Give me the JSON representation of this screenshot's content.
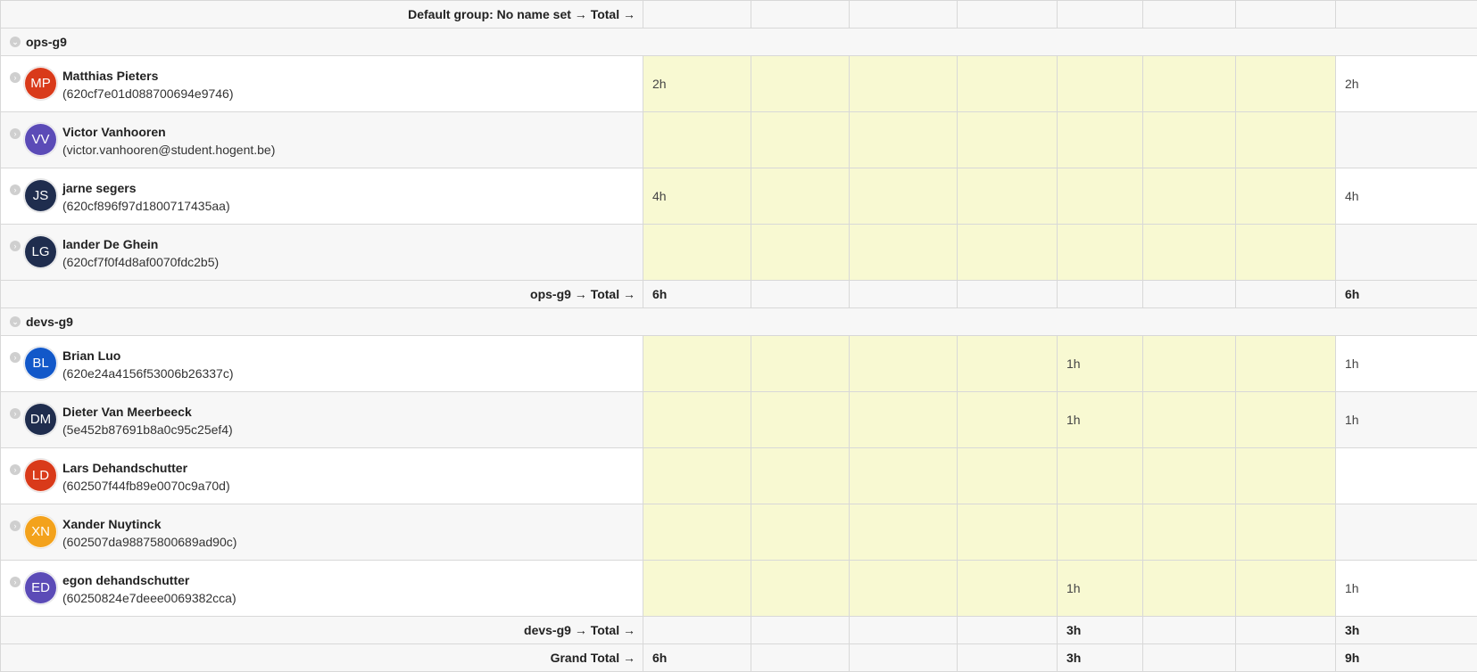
{
  "default_total": {
    "label": "Default group: No name set → Total →"
  },
  "groups": [
    {
      "name": "ops-g9",
      "members": [
        {
          "initials": "MP",
          "name": "Matthias Pieters",
          "sub": "(620cf7e01d088700694e9746)",
          "color": "#d93a1a",
          "days": [
            "2h",
            "",
            "",
            "",
            "",
            "",
            ""
          ],
          "total": "2h"
        },
        {
          "initials": "VV",
          "name": "Victor Vanhooren",
          "sub": "(victor.vanhooren@student.hogent.be)",
          "color": "#5b4bb7",
          "days": [
            "",
            "",
            "",
            "",
            "",
            "",
            ""
          ],
          "total": ""
        },
        {
          "initials": "JS",
          "name": "jarne segers",
          "sub": "(620cf896f97d1800717435aa)",
          "color": "#1f2d4e",
          "days": [
            "4h",
            "",
            "",
            "",
            "",
            "",
            ""
          ],
          "total": "4h"
        },
        {
          "initials": "LG",
          "name": "lander De Ghein",
          "sub": "(620cf7f0f4d8af0070fdc2b5)",
          "color": "#1f2d4e",
          "days": [
            "",
            "",
            "",
            "",
            "",
            "",
            ""
          ],
          "total": ""
        }
      ],
      "total": {
        "label": "ops-g9 → Total →",
        "days": [
          "6h",
          "",
          "",
          "",
          "",
          "",
          ""
        ],
        "total": "6h"
      }
    },
    {
      "name": "devs-g9",
      "members": [
        {
          "initials": "BL",
          "name": "Brian Luo",
          "sub": "(620e24a4156f53006b26337c)",
          "color": "#1258c9",
          "days": [
            "",
            "",
            "",
            "",
            "1h",
            "",
            ""
          ],
          "total": "1h"
        },
        {
          "initials": "DM",
          "name": "Dieter Van Meerbeeck",
          "sub": "(5e452b87691b8a0c95c25ef4)",
          "color": "#1f2d4e",
          "days": [
            "",
            "",
            "",
            "",
            "1h",
            "",
            ""
          ],
          "total": "1h"
        },
        {
          "initials": "LD",
          "name": "Lars Dehandschutter",
          "sub": "(602507f44fb89e0070c9a70d)",
          "color": "#d93a1a",
          "days": [
            "",
            "",
            "",
            "",
            "",
            "",
            ""
          ],
          "total": ""
        },
        {
          "initials": "XN",
          "name": "Xander Nuytinck",
          "sub": "(602507da98875800689ad90c)",
          "color": "#f3a21c",
          "days": [
            "",
            "",
            "",
            "",
            "",
            "",
            ""
          ],
          "total": ""
        },
        {
          "initials": "ED",
          "name": "egon dehandschutter",
          "sub": "(60250824e7deee0069382cca)",
          "color": "#5b4bb7",
          "days": [
            "",
            "",
            "",
            "",
            "1h",
            "",
            ""
          ],
          "total": "1h"
        }
      ],
      "total": {
        "label": "devs-g9 → Total →",
        "days": [
          "",
          "",
          "",
          "",
          "3h",
          "",
          ""
        ],
        "total": "3h"
      }
    }
  ],
  "grand_total": {
    "label": "Grand Total →",
    "days": [
      "6h",
      "",
      "",
      "",
      "3h",
      "",
      ""
    ],
    "total": "9h"
  }
}
